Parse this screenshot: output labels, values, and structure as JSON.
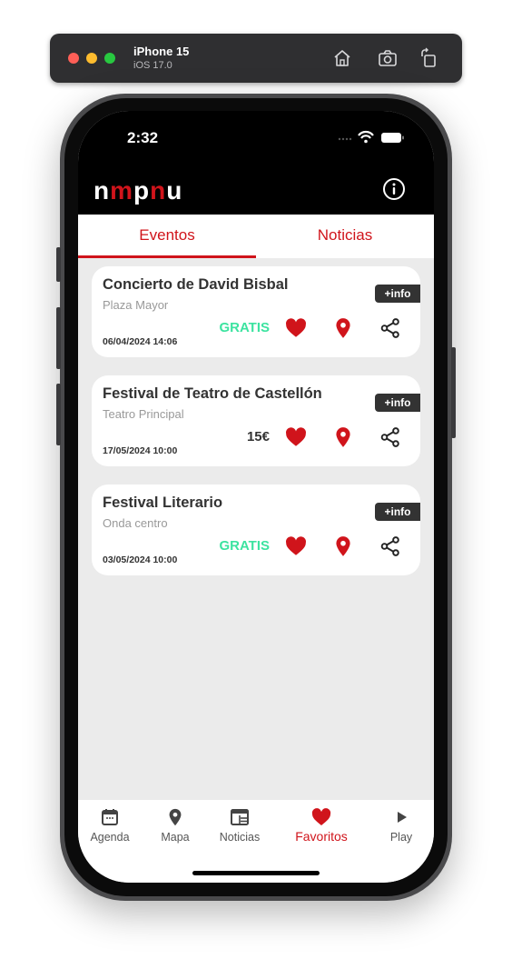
{
  "simulator": {
    "device": "iPhone 15",
    "os": "iOS 17.0",
    "home_icon": "home-icon",
    "screenshot_icon": "camera-icon",
    "rotate_icon": "rotate-icon"
  },
  "status_bar": {
    "time": "2:32"
  },
  "header": {
    "logo_parts": [
      "n",
      "m",
      "p",
      "n",
      "u"
    ],
    "info_icon": "info-circle-icon"
  },
  "tabs": [
    {
      "label": "Eventos",
      "active": true
    },
    {
      "label": "Noticias",
      "active": false
    }
  ],
  "events": [
    {
      "title": "Concierto de David Bisbal",
      "venue": "Plaza Mayor",
      "date": "06/04/2024 14:06",
      "price": "GRATIS",
      "free": true,
      "info_label": "+info"
    },
    {
      "title": "Festival de Teatro de Castellón",
      "venue": "Teatro Principal",
      "date": "17/05/2024 10:00",
      "price": "15€",
      "free": false,
      "info_label": "+info"
    },
    {
      "title": "Festival Literario",
      "venue": "Onda centro",
      "date": "03/05/2024 10:00",
      "price": "GRATIS",
      "free": true,
      "info_label": "+info"
    }
  ],
  "bottom_nav": [
    {
      "label": "Agenda",
      "icon": "calendar-icon",
      "active": false
    },
    {
      "label": "Mapa",
      "icon": "map-pin-icon",
      "active": false
    },
    {
      "label": "Noticias",
      "icon": "newspaper-icon",
      "active": false
    },
    {
      "label": "Favoritos",
      "icon": "heart-icon",
      "active": true
    },
    {
      "label": "Play",
      "icon": "play-icon",
      "active": false
    }
  ],
  "colors": {
    "accent": "#d0141b",
    "free": "#3ce3a0",
    "text": "#333333",
    "background": "#ebebeb"
  }
}
